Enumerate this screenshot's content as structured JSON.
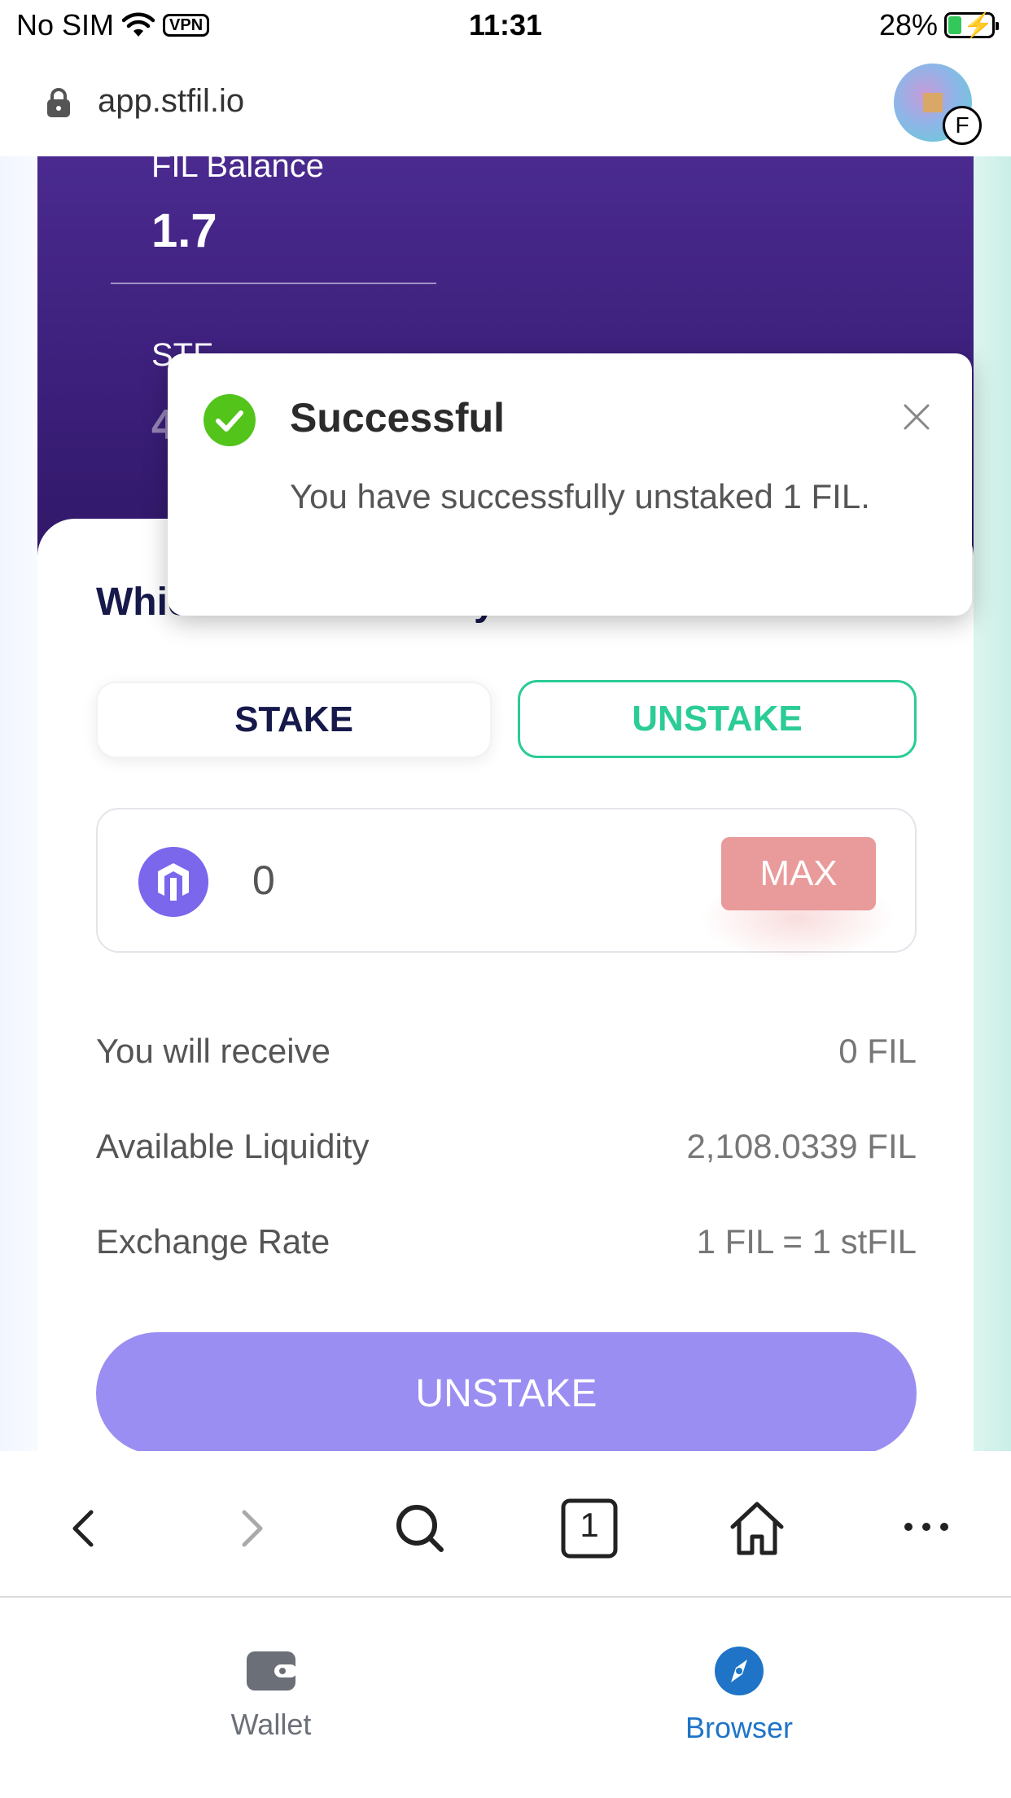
{
  "status_bar": {
    "carrier": "No SIM",
    "vpn": "VPN",
    "time": "11:31",
    "battery": "28%"
  },
  "url_bar": {
    "url": "app.stfil.io",
    "avatar_badge": "F"
  },
  "balance_card": {
    "fil_balance_label": "FIL Balance",
    "fil_balance_value": "1.7",
    "stfil_label": "STF",
    "stfil_value": "49"
  },
  "toast": {
    "title": "Successful",
    "message": "You have successfully unstaked 1 FIL."
  },
  "action_panel": {
    "title": "Which action would you like to choose?",
    "tab_stake": "STAKE",
    "tab_unstake": "UNSTAKE",
    "amount_value": "0",
    "max_label": "MAX",
    "receive_label": "You will receive",
    "receive_value": "0 FIL",
    "liquidity_label": "Available Liquidity",
    "liquidity_value": "2,108.0339 FIL",
    "rate_label": "Exchange Rate",
    "rate_value": "1 FIL = 1 stFIL",
    "submit_label": "UNSTAKE"
  },
  "toolbar": {
    "tab_count": "1"
  },
  "tabbar": {
    "wallet_label": "Wallet",
    "browser_label": "Browser"
  },
  "colors": {
    "accent_green": "#2bcc96",
    "brand_purple": "#9b8ef2",
    "max_red": "#e99a9a",
    "browser_blue": "#1f74c7"
  }
}
